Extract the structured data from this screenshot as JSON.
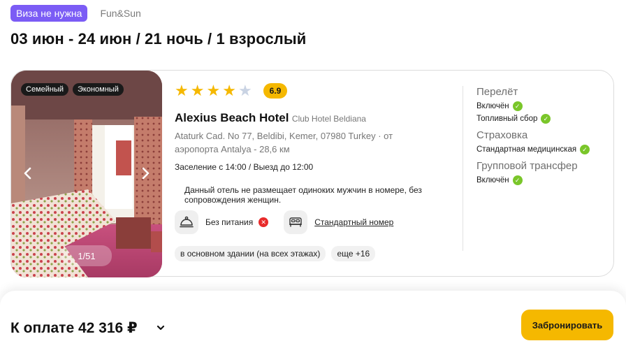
{
  "header": {
    "visa_badge": "Виза не нужна",
    "operator": "Fun&Sun",
    "trip_title": "03 июн - 24 июн / 21 ночь / 1 взрослый"
  },
  "hotel": {
    "tags": [
      "Семейный",
      "Экономный"
    ],
    "photo_counter": "1/51",
    "stars": 4,
    "stars_max": 5,
    "score": "6.9",
    "name": "Alexius Beach Hotel",
    "brand": "Club Hotel Beldiana",
    "address": "Ataturk Cad. No 77, Beldibi, Kemer, 07980 Turkey  ·  от аэропорта Antalya - 28,6 км",
    "checkin": "Заселение с 14:00 / Выезд до 12:00",
    "notice": "Данный отель не размещает одиноких мужчин в номере, без сопровождения женщин.",
    "meal": {
      "label": "Без питания",
      "icon": "cloche-icon",
      "status": "not-included"
    },
    "room": {
      "label": "Стандартный номер",
      "icon": "bed-icon"
    },
    "chips": [
      "в основном здании (на всех этажах)",
      "еще +16"
    ]
  },
  "includes": {
    "flight": {
      "heading": "Перелёт",
      "items": [
        "Включён",
        "Топливный сбор"
      ]
    },
    "insurance": {
      "heading": "Страховка",
      "items": [
        "Стандартная медицинская"
      ]
    },
    "transfer": {
      "heading": "Групповой трансфер",
      "items": [
        "Включён"
      ]
    }
  },
  "footer": {
    "pay_label": "К оплате 42 316 ₽",
    "book_label": "Забронировать"
  },
  "colors": {
    "accent": "#f5b800",
    "visa_badge": "#7b5cf5",
    "check": "#7ac62a",
    "cross": "#e82b2b"
  }
}
